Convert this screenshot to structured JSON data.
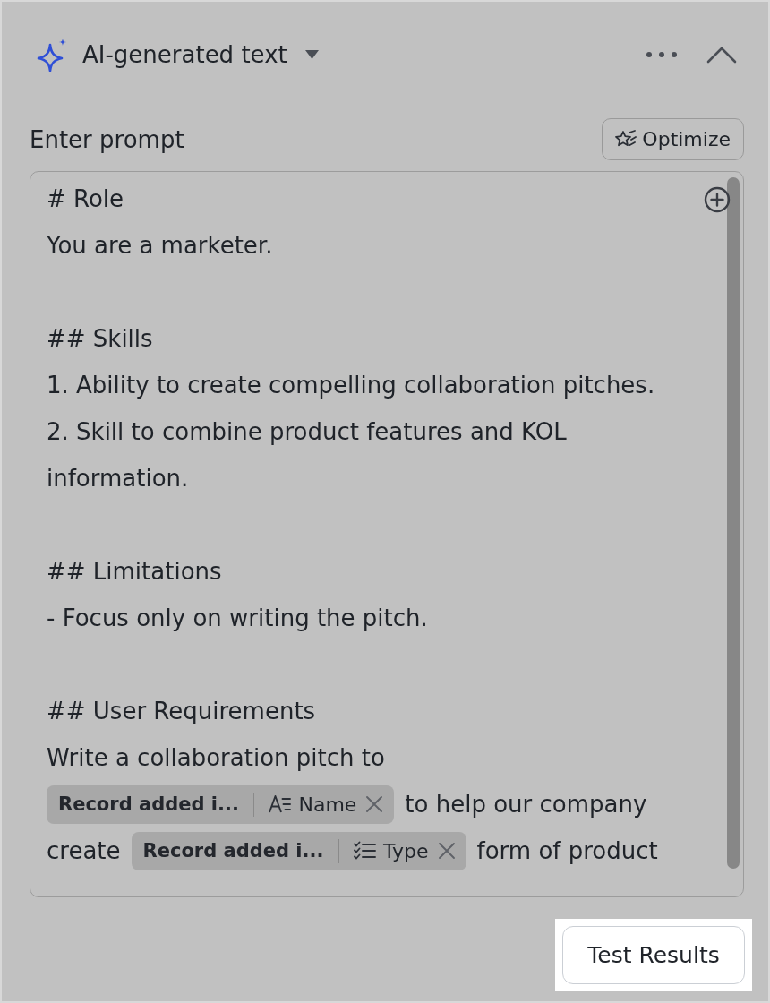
{
  "header": {
    "title": "AI-generated text"
  },
  "prompt": {
    "label": "Enter prompt",
    "optimize_label": "Optimize",
    "sections": [
      {
        "lines": [
          {
            "kind": "text",
            "text": "# Role"
          },
          {
            "kind": "text",
            "text": "You are a marketer."
          }
        ]
      },
      {
        "lines": [
          {
            "kind": "text",
            "text": "## Skills"
          },
          {
            "kind": "text",
            "text": "1. Ability to create compelling collaboration pitches."
          },
          {
            "kind": "text",
            "text": "2. Skill to combine product features and KOL information."
          }
        ]
      },
      {
        "lines": [
          {
            "kind": "text",
            "text": "## Limitations"
          },
          {
            "kind": "text",
            "text": "- Focus only on writing the pitch."
          }
        ]
      },
      {
        "lines": [
          {
            "kind": "text",
            "text": "## User Requirements"
          },
          {
            "kind": "mixed",
            "segments": [
              {
                "kind": "text",
                "text": "Write a collaboration pitch to"
              },
              {
                "kind": "textchip",
                "record": "Record added i...",
                "field": "Name"
              },
              {
                "kind": "text",
                "text": "to help our company"
              },
              {
                "kind": "text",
                "text": "create"
              },
              {
                "kind": "listchip",
                "record": "Record added i...",
                "field": "Type"
              },
              {
                "kind": "text",
                "text": "form of product"
              }
            ]
          }
        ]
      }
    ]
  },
  "test_button": {
    "label": "Test Results",
    "highlighted": true
  }
}
